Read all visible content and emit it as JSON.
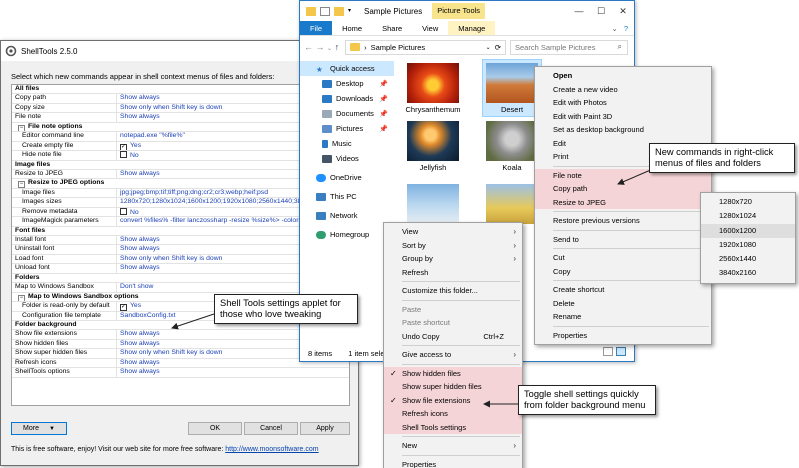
{
  "shelltools": {
    "title": "ShellTools 2.5.0",
    "intro": "Select which new commands appear in shell context menus of files and folders:",
    "rows": [
      {
        "kind": "header",
        "label": "All files"
      },
      {
        "kind": "item",
        "label": "Copy path",
        "value": "Show always"
      },
      {
        "kind": "item",
        "label": "Copy size",
        "value": "Show only when Shift key is down"
      },
      {
        "kind": "item",
        "label": "File note",
        "value": "Show always"
      },
      {
        "kind": "sub",
        "label": "File note options"
      },
      {
        "kind": "item",
        "indent": true,
        "label": "Editor command line",
        "value": "notepad.exe \"%file%\""
      },
      {
        "kind": "item",
        "indent": true,
        "label": "Create empty file",
        "value": "Yes",
        "check": "yes"
      },
      {
        "kind": "item",
        "indent": true,
        "label": "Hide note file",
        "value": "No",
        "check": "no"
      },
      {
        "kind": "header",
        "label": "Image files"
      },
      {
        "kind": "item",
        "label": "Resize to JPEG",
        "value": "Show always"
      },
      {
        "kind": "sub",
        "label": "Resize to JPEG options"
      },
      {
        "kind": "item",
        "indent": true,
        "label": "Image files",
        "value": "jpg;jpeg;bmp;tif;tiff;png;dng;cr2;cr3;webp;heif;psd"
      },
      {
        "kind": "item",
        "indent": true,
        "label": "Images sizes",
        "value": "1280x720;1280x1024;1600x1200;1920x1080;2560x1440;3840x2160"
      },
      {
        "kind": "item",
        "indent": true,
        "label": "Remove metadata",
        "value": "No",
        "check": "no"
      },
      {
        "kind": "item",
        "indent": true,
        "label": "ImageMagick parameters",
        "value": "convert %files% -filter lanczossharp -resize %size%> -colorspace sRGB"
      },
      {
        "kind": "header",
        "label": "Font files"
      },
      {
        "kind": "item",
        "label": "Install font",
        "value": "Show always"
      },
      {
        "kind": "item",
        "label": "Uninstall font",
        "value": "Show always"
      },
      {
        "kind": "item",
        "label": "Load font",
        "value": "Show only when Shift key is down"
      },
      {
        "kind": "item",
        "label": "Unload font",
        "value": "Show always"
      },
      {
        "kind": "header",
        "label": "Folders"
      },
      {
        "kind": "item",
        "label": "Map to Windows Sandbox",
        "value": "Don't show"
      },
      {
        "kind": "sub",
        "label": "Map to Windows Sandbox options"
      },
      {
        "kind": "item",
        "indent": true,
        "label": "Folder is read-only by default",
        "value": "Yes",
        "check": "yes"
      },
      {
        "kind": "item",
        "indent": true,
        "label": "Configuration file template",
        "value": "SandboxConfig.txt"
      },
      {
        "kind": "header",
        "label": "Folder background"
      },
      {
        "kind": "item",
        "label": "Show file extensions",
        "value": "Show always"
      },
      {
        "kind": "item",
        "label": "Show hidden files",
        "value": "Show always"
      },
      {
        "kind": "item",
        "label": "Show super hidden files",
        "value": "Show only when Shift key is down"
      },
      {
        "kind": "item",
        "label": "Refresh icons",
        "value": "Show always"
      },
      {
        "kind": "item",
        "label": "ShellTools options",
        "value": "Show always"
      }
    ],
    "buttons": {
      "more": "More",
      "ok": "OK",
      "cancel": "Cancel",
      "apply": "Apply"
    },
    "footer_text": "This is free software, enjoy! Visit our web site for more free software:",
    "footer_link": "http://www.moonsoftware.com"
  },
  "explorer": {
    "title": "Sample Pictures",
    "context_tab": "Picture Tools",
    "tabs": [
      "File",
      "Home",
      "Share",
      "View",
      "Manage"
    ],
    "path": "Sample Pictures",
    "search_placeholder": "Search Sample Pictures",
    "nav": [
      "Quick access",
      "Desktop",
      "Downloads",
      "Documents",
      "Pictures",
      "Music",
      "Videos",
      "OneDrive",
      "This PC",
      "Network",
      "Homegroup"
    ],
    "thumbs": [
      "Chrysanthemum",
      "Desert",
      "Jellyfish",
      "Koala",
      "",
      ""
    ],
    "status_count": "8 items",
    "status_selected": "1 item sele"
  },
  "file_menu": {
    "items": [
      "Open",
      "Create a new video",
      "Edit with Photos",
      "Edit with Paint 3D",
      "Set as desktop background",
      "Edit",
      "Print",
      "File note",
      "Copy path",
      "Resize to JPEG",
      "Restore previous versions",
      "Send to",
      "Cut",
      "Copy",
      "Create shortcut",
      "Delete",
      "Rename",
      "Properties"
    ]
  },
  "resize_submenu": {
    "items": [
      "1280x720",
      "1280x1024",
      "1600x1200",
      "1920x1080",
      "2560x1440",
      "3840x2160"
    ]
  },
  "bg_menu": {
    "items": [
      "View",
      "Sort by",
      "Group by",
      "Refresh",
      "Customize this folder...",
      "Paste",
      "Paste shortcut",
      "Undo Copy",
      "Give access to",
      "Show hidden files",
      "Show super hidden files",
      "Show file extensions",
      "Refresh icons",
      "Shell Tools settings",
      "New",
      "Properties"
    ],
    "undo_shortcut": "Ctrl+Z"
  },
  "callouts": {
    "file_menu": "New commands in right-click menus of files and folders",
    "settings": "Shell Tools settings applet for those who love tweaking",
    "background": "Toggle shell settings quickly from folder background menu"
  },
  "colors": {
    "highlight": "#f5d4d7",
    "accent": "#1979ca",
    "link": "#1a3fb5"
  }
}
